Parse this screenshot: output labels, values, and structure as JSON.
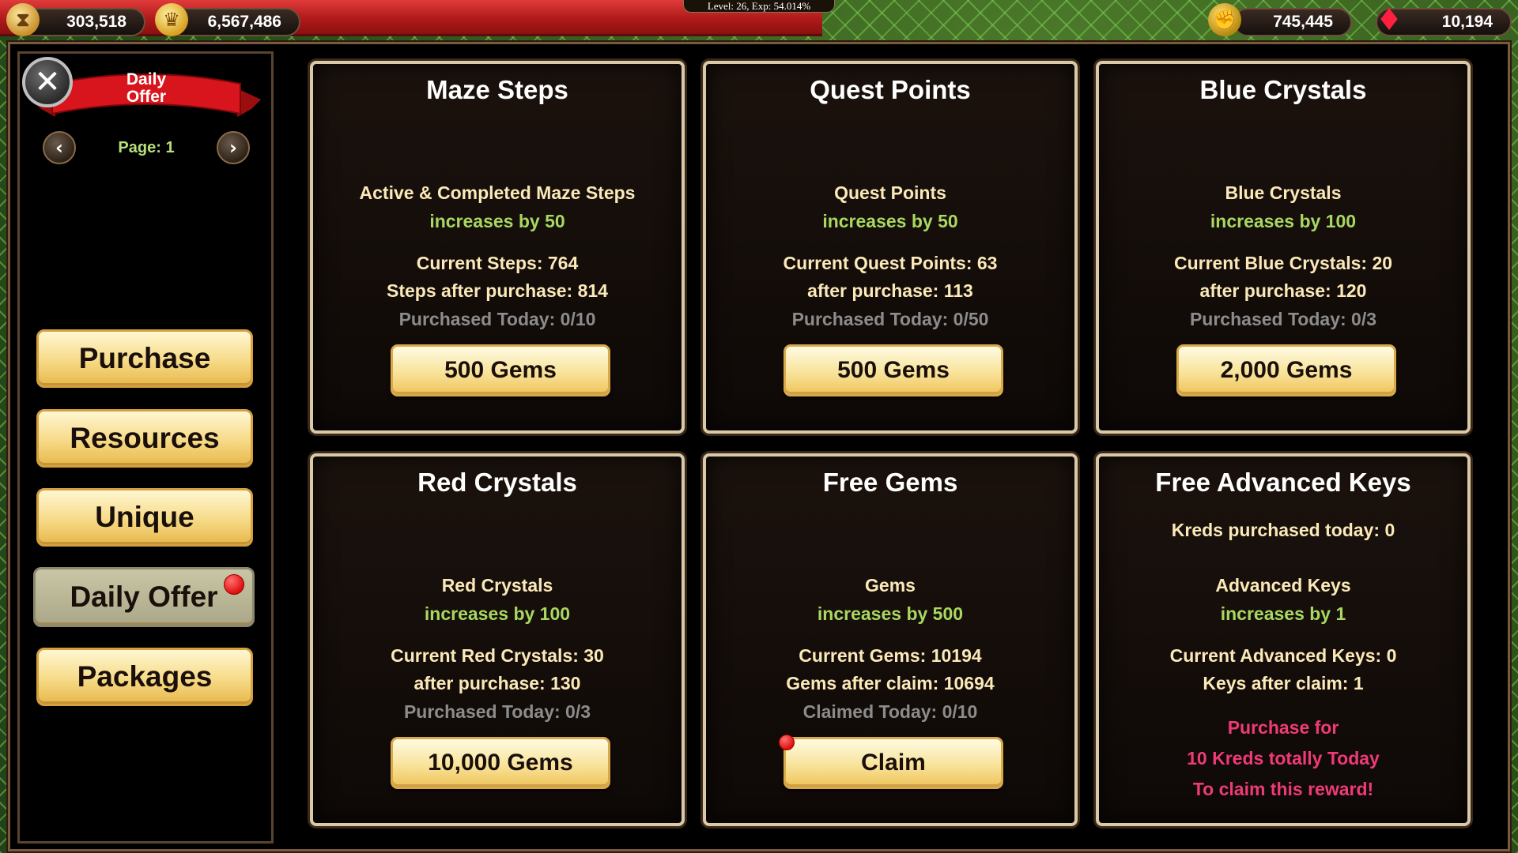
{
  "hud": {
    "resource1": "303,518",
    "resource2": "6,567,486",
    "level_text": "Level: 26, Exp: 54.014%",
    "resource3": "745,445",
    "gems": "10,194"
  },
  "sidebar": {
    "ribbon": "Daily\nOffer",
    "page_label": "Page: 1",
    "buttons": {
      "purchase": "Purchase",
      "resources": "Resources",
      "unique": "Unique",
      "daily_offer": "Daily Offer",
      "packages": "Packages"
    }
  },
  "cards": {
    "maze": {
      "title": "Maze Steps",
      "item": "Active & Completed Maze Steps",
      "increase": "increases by   50",
      "current": "Current Steps:   764",
      "after": "Steps after purchase:   814",
      "today": "Purchased Today: 0/10",
      "button": "500 Gems"
    },
    "quest": {
      "title": "Quest Points",
      "item": "Quest Points",
      "increase": "increases by   50",
      "current": "Current Quest Points:   63",
      "after": "after purchase:   113",
      "today": "Purchased Today: 0/50",
      "button": "500 Gems"
    },
    "blue": {
      "title": "Blue Crystals",
      "item": "Blue Crystals",
      "increase": "increases by   100",
      "current": "Current Blue Crystals:   20",
      "after": "after purchase:   120",
      "today": "Purchased Today: 0/3",
      "button": "2,000 Gems"
    },
    "red": {
      "title": "Red Crystals",
      "item": "Red Crystals",
      "increase": "increases by   100",
      "current": "Current Red Crystals:   30",
      "after": "after purchase:   130",
      "today": "Purchased Today: 0/3",
      "button": "10,000 Gems"
    },
    "free_gems": {
      "title": "Free Gems",
      "item": "Gems",
      "increase": "increases by   500",
      "current": "Current Gems:   10194",
      "after": "Gems after claim:   10694",
      "today": "Claimed Today: 0/10",
      "button": "Claim"
    },
    "keys": {
      "title": "Free Advanced Keys",
      "kreds": "Kreds purchased today:   0",
      "item": "Advanced Keys",
      "increase": "increases by   1",
      "current": "Current Advanced Keys:   0",
      "after": "Keys after claim:   1",
      "note1": "Purchase for",
      "note2": "10 Kreds totally Today",
      "note3": "To claim this reward!"
    }
  },
  "colors": {
    "accent_green": "#a8d860",
    "highlight_pink": "#f03a78",
    "button_gold": "#f6da86",
    "notification_red": "#e01010"
  }
}
